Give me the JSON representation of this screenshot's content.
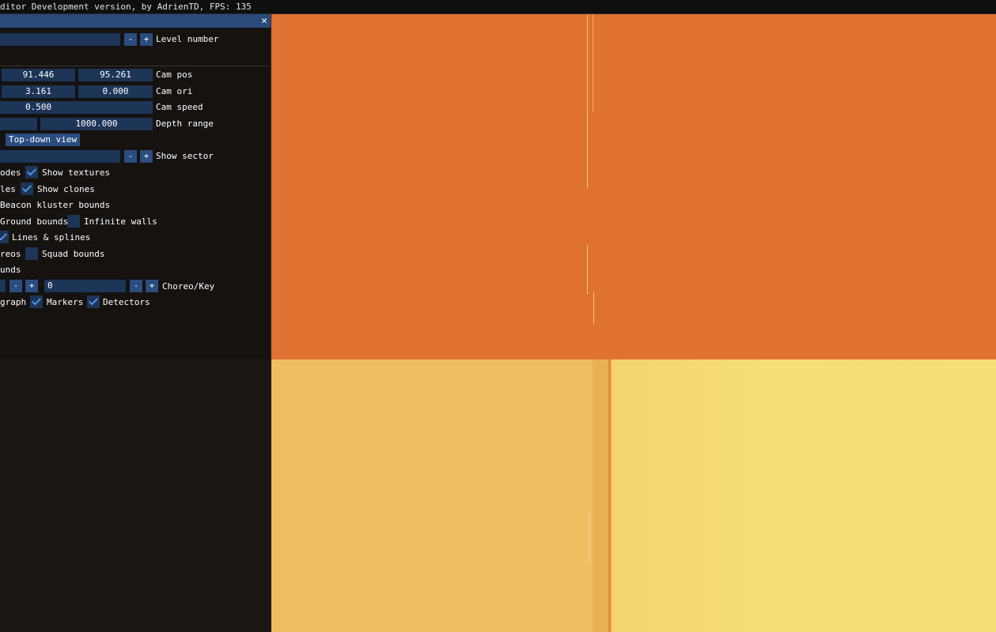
{
  "window": {
    "title": "ditor Development version, by AdrienTD, FPS: 135"
  },
  "panel": {
    "close_glyph": "✕",
    "level": {
      "label": "Level number",
      "minus": "-",
      "plus": "+"
    },
    "cam_pos": {
      "label": "Cam pos",
      "values": [
        "91.446",
        "95.261"
      ]
    },
    "cam_ori": {
      "label": "Cam ori",
      "values": [
        "3.161",
        "0.000"
      ]
    },
    "cam_speed": {
      "label": "Cam speed",
      "value": "0.500"
    },
    "depth_range": {
      "label": "Depth range",
      "value": "1000.000"
    },
    "topdown_label": "Top-down view",
    "show_sector": {
      "label": "Show sector",
      "minus": "-",
      "plus": "+"
    },
    "checks": {
      "nodes": {
        "label": "odes"
      },
      "show_textures": {
        "label": "Show textures",
        "checked": true
      },
      "les": {
        "label": "les"
      },
      "show_clones": {
        "label": "Show clones",
        "checked": true
      },
      "beacon_kluster": {
        "label": "Beacon kluster bounds"
      },
      "ground_bounds": {
        "label": "Ground bounds"
      },
      "infinite_walls": {
        "label": "Infinite walls",
        "checked": false
      },
      "lines_splines": {
        "label": "Lines & splines",
        "checked": true
      },
      "reos": {
        "label": "reos"
      },
      "squad_bounds": {
        "label": "Squad bounds",
        "checked": false
      },
      "unds": {
        "label": "unds"
      },
      "graph": {
        "label": "graph"
      },
      "markers": {
        "label": "Markers",
        "checked": true
      },
      "detectors": {
        "label": "Detectors",
        "checked": true
      }
    },
    "choreo": {
      "label": "Choreo/Key",
      "value": "0",
      "minus": "-",
      "plus": "+"
    }
  },
  "colors": {
    "viewport_top": "#df7230",
    "viewport_bottom_left": "#eebe60",
    "viewport_bottom_right": "#f7de76",
    "panel_header": "#294a7a",
    "field_bg": "#1d3557",
    "button_bg": "#2a4d80",
    "check_mark": "#4e93e8"
  }
}
